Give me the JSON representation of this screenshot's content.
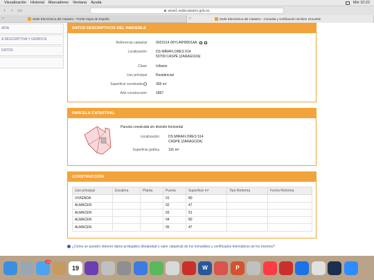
{
  "menubar": {
    "items": [
      "Visualización",
      "Historial",
      "Marcadores",
      "Ventana",
      "Ayuda"
    ],
    "clock": "Mié 10:22"
  },
  "browser": {
    "url": "www1.sedecatastro.gob.es",
    "tabs": [
      {
        "label": "Sede Electrónica del Catastro - Portal Hojas de España",
        "active": false
      },
      {
        "label": "Sede Electrónica del Catastro - Consulta y certificación de Bien Inmueble",
        "active": true
      }
    ]
  },
  "sidenav": {
    "items": [
      "AFÍA",
      "A DESCRIPTIVA Y GRÁFICA",
      "DATOS"
    ]
  },
  "descriptivos": {
    "title": "DATOS DESCRIPTIVOS DEL INMUEBLE",
    "labels": {
      "referencia": "Referencia catastral",
      "localizacion": "Localización",
      "clase": "Clase",
      "uso": "Uso principal",
      "superficie": "Superficie construida",
      "anio": "Año construcción"
    },
    "values": {
      "referencia": "0021514 00YL46H0001AA",
      "localizacion_1": "DS MIRAFLORES 514",
      "localizacion_2": "50709 CASPE (ZARAGOZA)",
      "clase": "Urbano",
      "uso": "Residencial",
      "superficie": "305 m²",
      "anio": "1897"
    }
  },
  "parcela": {
    "title": "PARCELA CATASTRAL",
    "descripcion": "Parcela construida sin división horizontal",
    "labels": {
      "localizacion": "Localización",
      "superficie": "Superficie gráfica"
    },
    "values": {
      "localizacion_1": "DS MIRAFLORES 514",
      "localizacion_2": "CASPE (ZARAGOZA)",
      "superficie": "191 m²"
    }
  },
  "construccion": {
    "title": "CONSTRUCCIÓN",
    "headers": [
      "Uso principal",
      "Escalera",
      "Planta",
      "Puerta",
      "Superficie m²",
      "Tipo Reforma",
      "Fecha Reforma"
    ],
    "rows": [
      [
        "VIVIENDA",
        "",
        "",
        "01",
        "80",
        "",
        ""
      ],
      [
        "ALMACEN",
        "",
        "",
        "02",
        "47",
        "",
        ""
      ],
      [
        "ALMACEN",
        "",
        "",
        "03",
        "51",
        "",
        ""
      ],
      [
        "ALMACEN",
        "",
        "",
        "04",
        "80",
        "",
        ""
      ],
      [
        "ALMACEN",
        "",
        "",
        "05",
        "47",
        "",
        ""
      ]
    ]
  },
  "footer": {
    "link": "¿Cómo se pueden obtener datos protegidos (titularidad y valor catastral) de los inmuebles y certificados telemáticos de los mismos?"
  },
  "dock": {
    "badges": {
      "mail": "276",
      "calendar": "19"
    },
    "icons": [
      "finder-icon",
      "launchpad-icon",
      "mail-icon",
      "contacts-icon",
      "calendar-icon",
      "imovie-icon",
      "no-entry-icon",
      "settings-icon",
      "safari-icon",
      "chart-icon",
      "preview-icon",
      "acrobat-icon",
      "word-icon",
      "pdf-icon",
      "powerpoint-icon",
      "no-entry-icon-2",
      "music-icon",
      "acrobat-icon-2",
      "teamviewer-icon",
      "chrome-icon",
      "quicktime-icon",
      "zoom-icon"
    ]
  },
  "colors": {
    "accent": "#f3a33b",
    "panel_border": "#f0a430",
    "link": "#3a5ea8",
    "parcel_fill": "#f6d9dc",
    "parcel_stroke": "#c0392b"
  }
}
